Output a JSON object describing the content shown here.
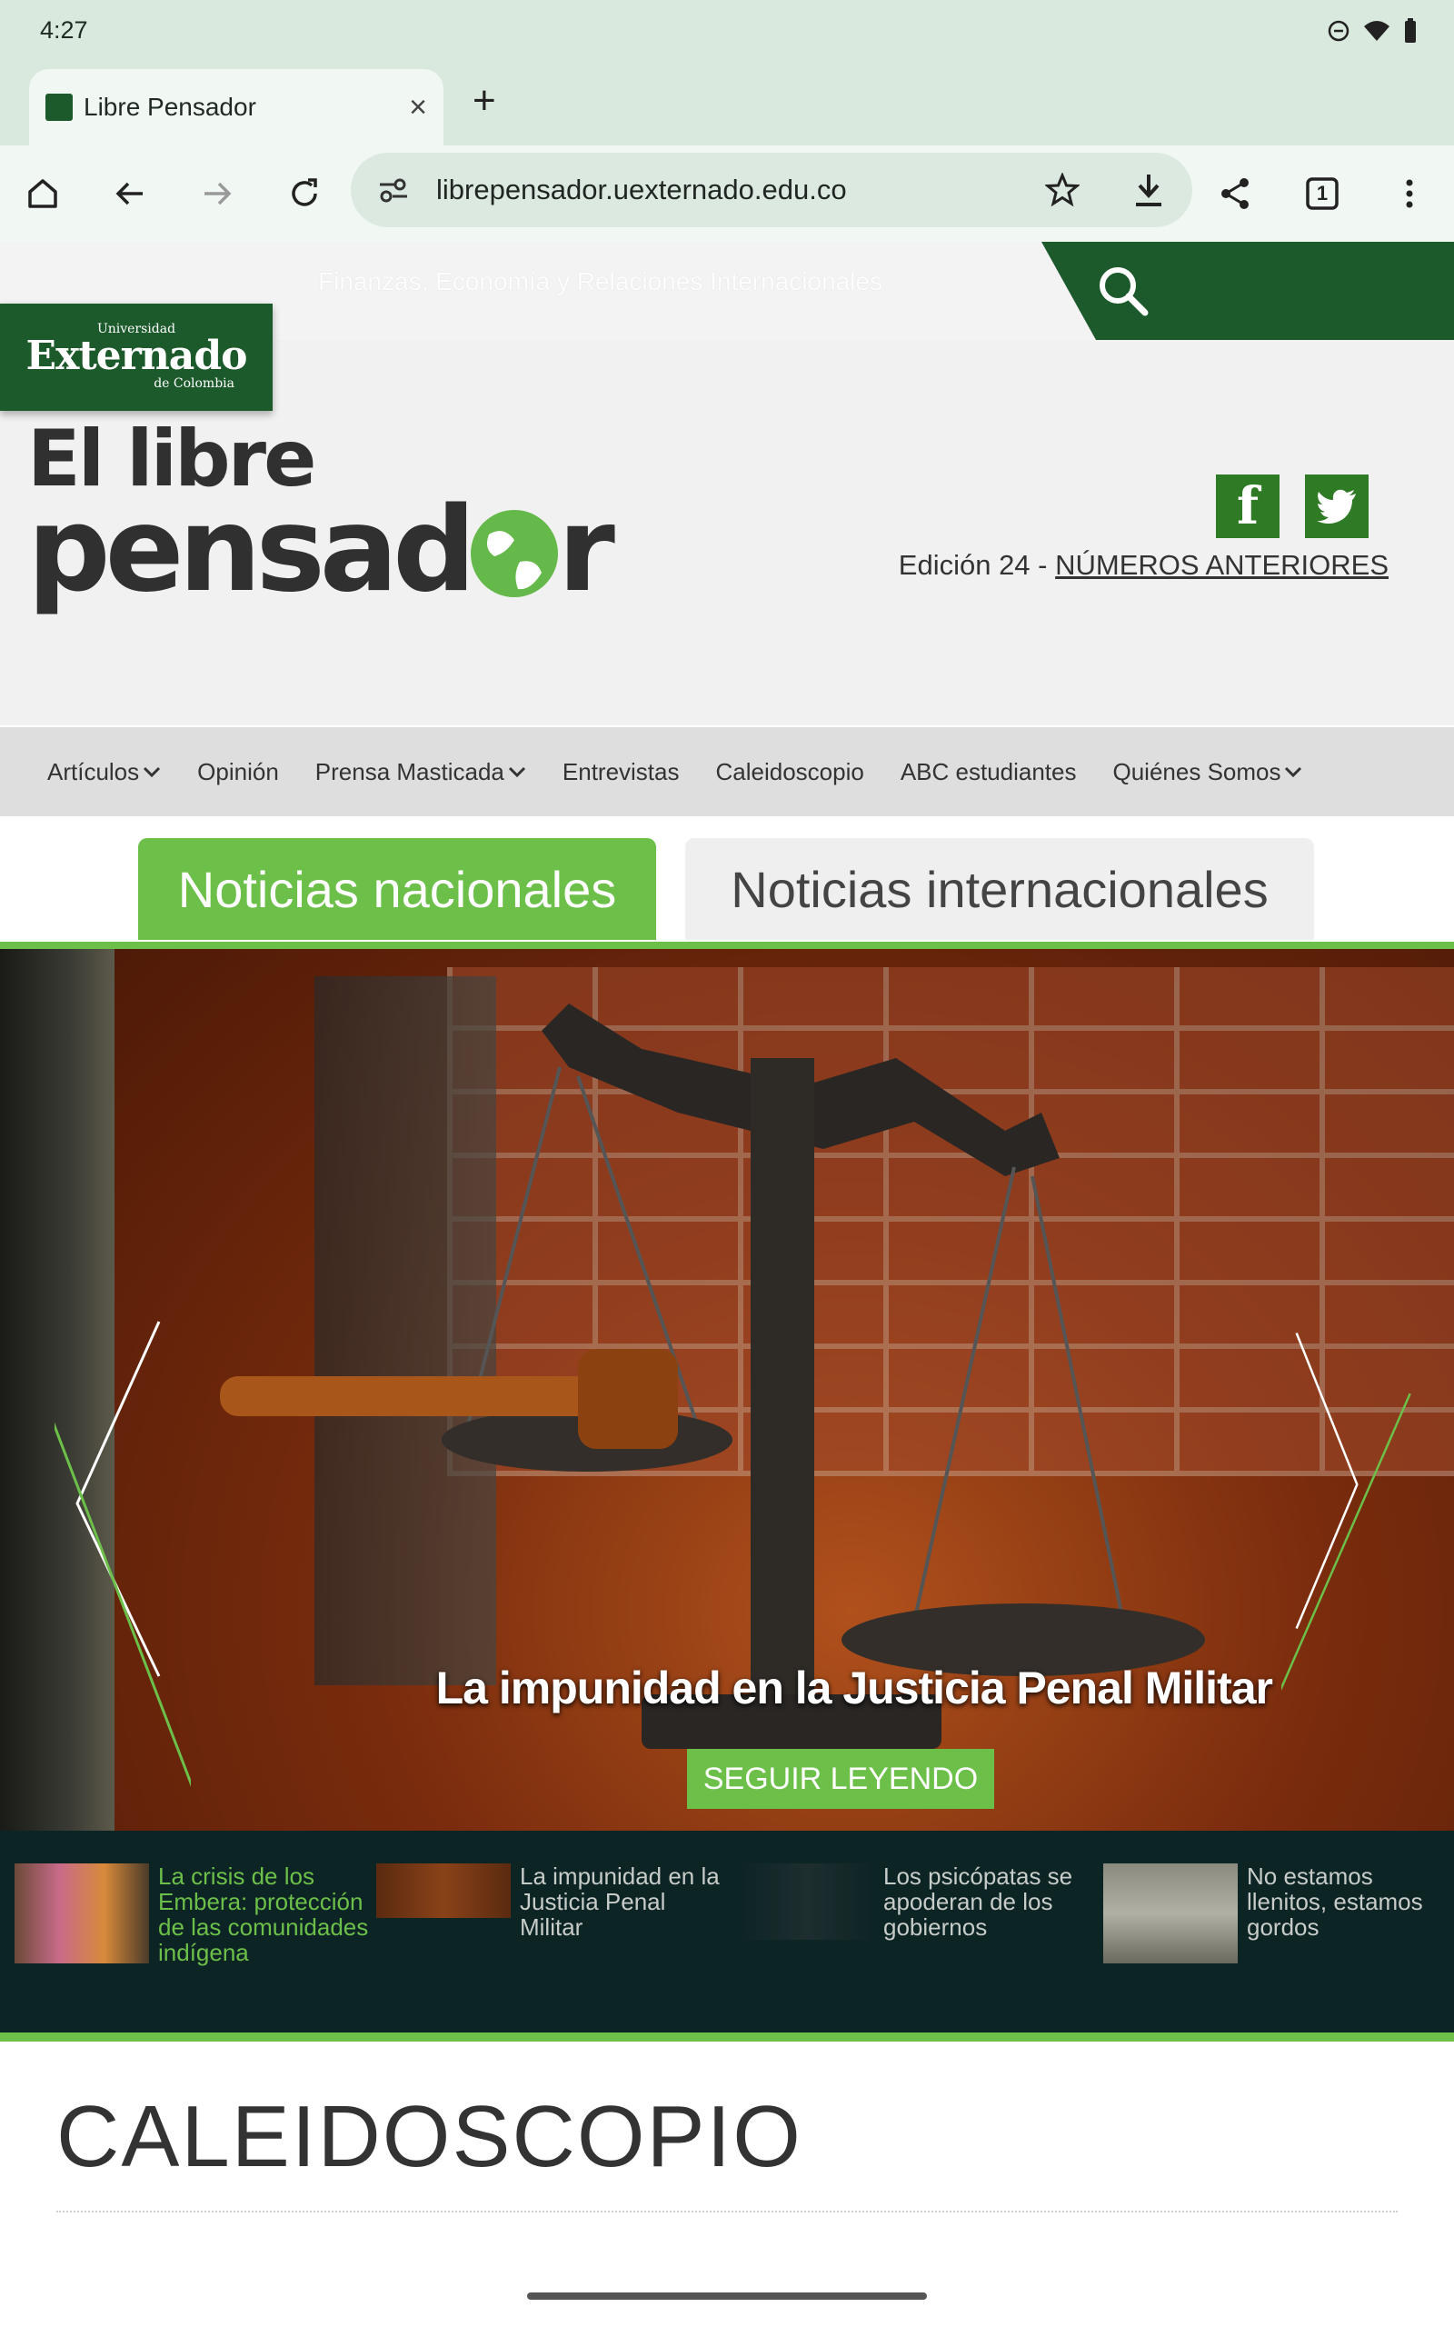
{
  "status": {
    "time": "4:27"
  },
  "browser": {
    "tab_title": "Libre Pensador",
    "url": "librepensador.uexternado.edu.co",
    "tab_count": "1"
  },
  "site": {
    "ticker": "Finanzas, Economía y Relaciones Internacionales",
    "badge": {
      "top": "Universidad",
      "main": "Externado",
      "bottom": "de Colombia"
    },
    "logo": {
      "line1": "El libre",
      "line2a": "pensad",
      "line2b": "r"
    },
    "edition": {
      "label": "Edición 24 - ",
      "link": "NÚMEROS ANTERIORES"
    },
    "social": {
      "facebook": "f"
    },
    "menu": [
      {
        "label": "Artículos",
        "dropdown": true
      },
      {
        "label": "Opinión",
        "dropdown": false
      },
      {
        "label": "Prensa Masticada",
        "dropdown": true
      },
      {
        "label": "Entrevistas",
        "dropdown": false
      },
      {
        "label": "Caleidoscopio",
        "dropdown": false
      },
      {
        "label": "ABC estudiantes",
        "dropdown": false
      },
      {
        "label": "Quiénes Somos",
        "dropdown": true
      }
    ],
    "tabs": {
      "national": "Noticias nacionales",
      "international": "Noticias internacionales"
    },
    "slide": {
      "title": "La impunidad en la Justicia Penal Militar",
      "button": "SEGUIR LEYENDO"
    },
    "thumbs": [
      {
        "text": "La crisis de los Embera: protección de las comunidades indígena",
        "active": true
      },
      {
        "text": "La impunidad en la Justicia Penal Militar",
        "active": false
      },
      {
        "text": "Los psicópatas se apoderan de los gobiernos",
        "active": false
      },
      {
        "text": "No estamos llenitos, estamos gordos",
        "active": false
      }
    ],
    "section": {
      "title": "CALEIDOSCOPIO"
    }
  },
  "colors": {
    "brand_green": "#1c5a2c",
    "accent_green": "#6cc04a",
    "thumb_bg": "#0d2424"
  }
}
